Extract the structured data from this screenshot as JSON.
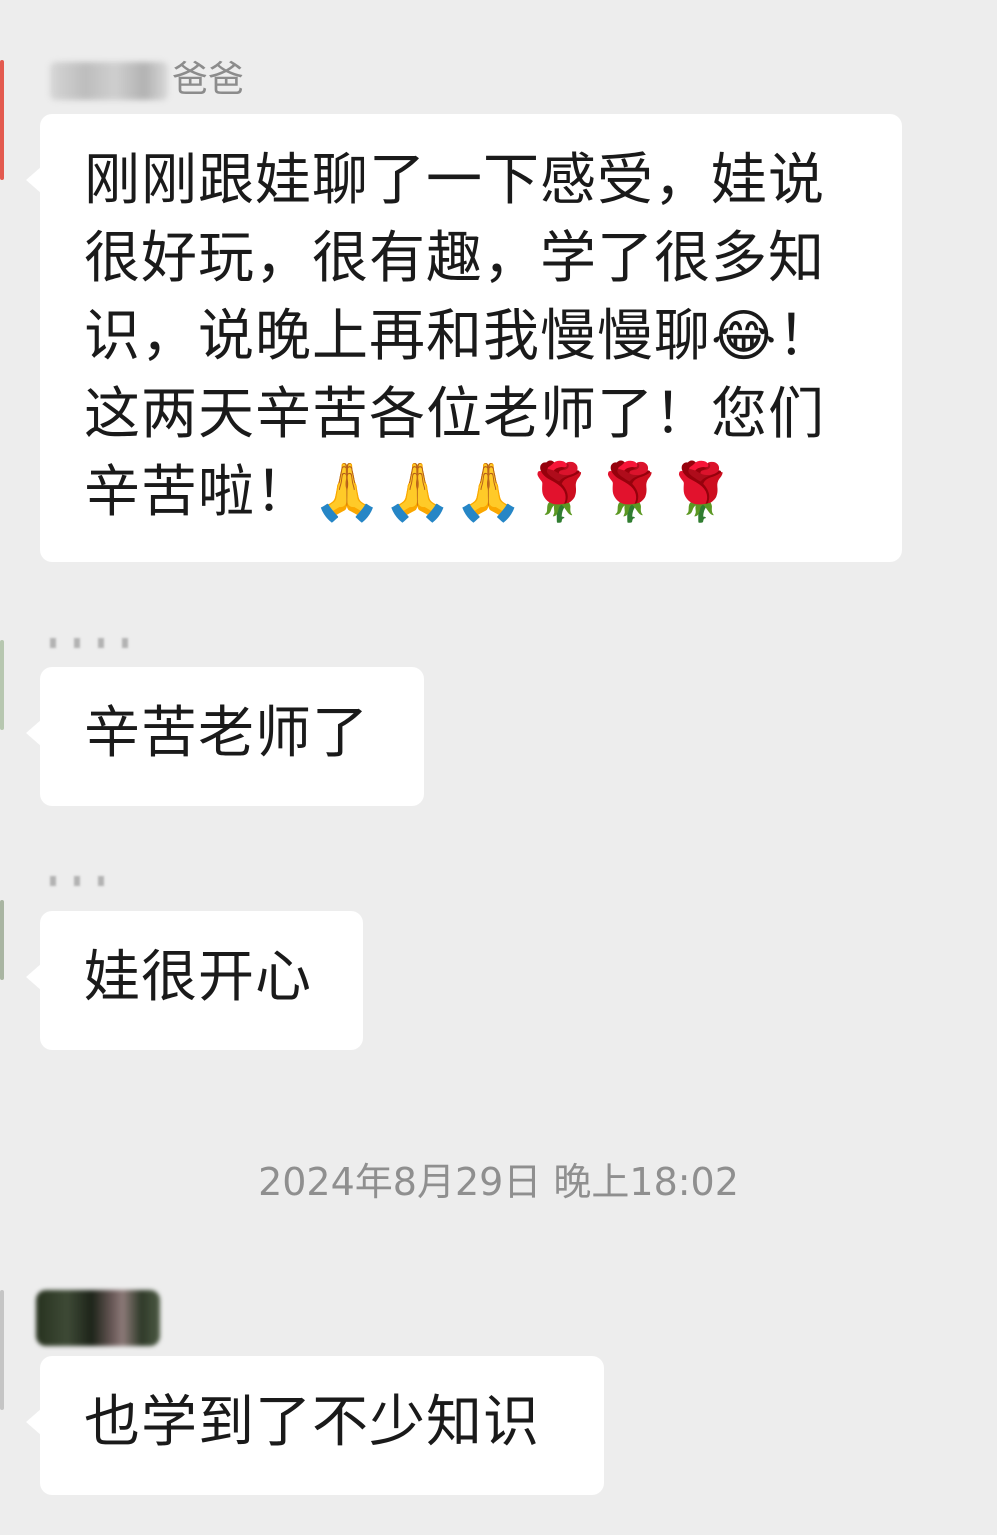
{
  "messages": [
    {
      "sender": "爸爸",
      "lines": [
        "刚刚跟娃聊了一下感受，娃说",
        "很好玩，很有趣，学了很多知",
        "识，说晚上再和我慢慢聊😂！",
        "这两天辛苦各位老师了！您们",
        "辛苦啦！🙏🙏🙏🌹🌹🌹"
      ]
    },
    {
      "lines": [
        "辛苦老师了"
      ]
    },
    {
      "lines": [
        "娃很开心"
      ]
    }
  ],
  "timestamp": "2024年8月29日 晚上18:02",
  "last_message": {
    "lines": [
      "也学到了不少知识"
    ]
  },
  "colors": {
    "background": "#ededed",
    "bubble": "#ffffff",
    "text": "#1a1a1a",
    "meta_text": "#8c8c8c"
  }
}
